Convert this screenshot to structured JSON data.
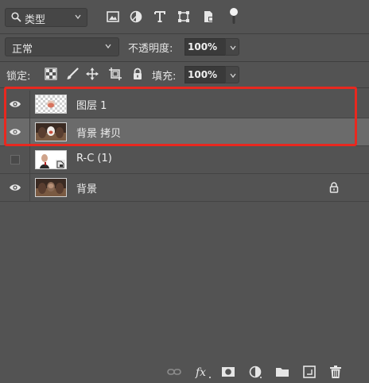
{
  "filter": {
    "kind_label": "类型"
  },
  "blend": {
    "mode": "正常",
    "opacity_label": "不透明度:",
    "opacity_value": "100%"
  },
  "lock": {
    "label": "锁定:",
    "fill_label": "填充:",
    "fill_value": "100%"
  },
  "layers": [
    {
      "name": "图层 1",
      "visible": true,
      "selected": false
    },
    {
      "name": "背景 拷贝",
      "visible": true,
      "selected": true
    },
    {
      "name": "R-C (1)",
      "visible": false,
      "selected": false
    },
    {
      "name": "背景",
      "visible": true,
      "selected": false,
      "locked": true
    }
  ],
  "colors": {
    "panel_bg": "#535353",
    "selected_row": "#6b6b6b",
    "highlight_border": "#e8281f"
  },
  "icons": {
    "filter_row": [
      "search-icon",
      "image-filter-icon",
      "adjustment-filter-icon",
      "type-filter-icon",
      "shape-filter-icon",
      "smart-object-filter-icon",
      "filter-toggle-icon"
    ],
    "lock_row": [
      "lock-transparent-pixels-icon",
      "lock-image-pixels-icon",
      "lock-position-icon",
      "lock-artboard-icon",
      "lock-all-icon"
    ],
    "bottom_bar": [
      "link-layers-icon",
      "fx-icon",
      "add-mask-icon",
      "adjustment-layer-icon",
      "new-group-icon",
      "new-layer-icon",
      "delete-layer-icon"
    ]
  }
}
